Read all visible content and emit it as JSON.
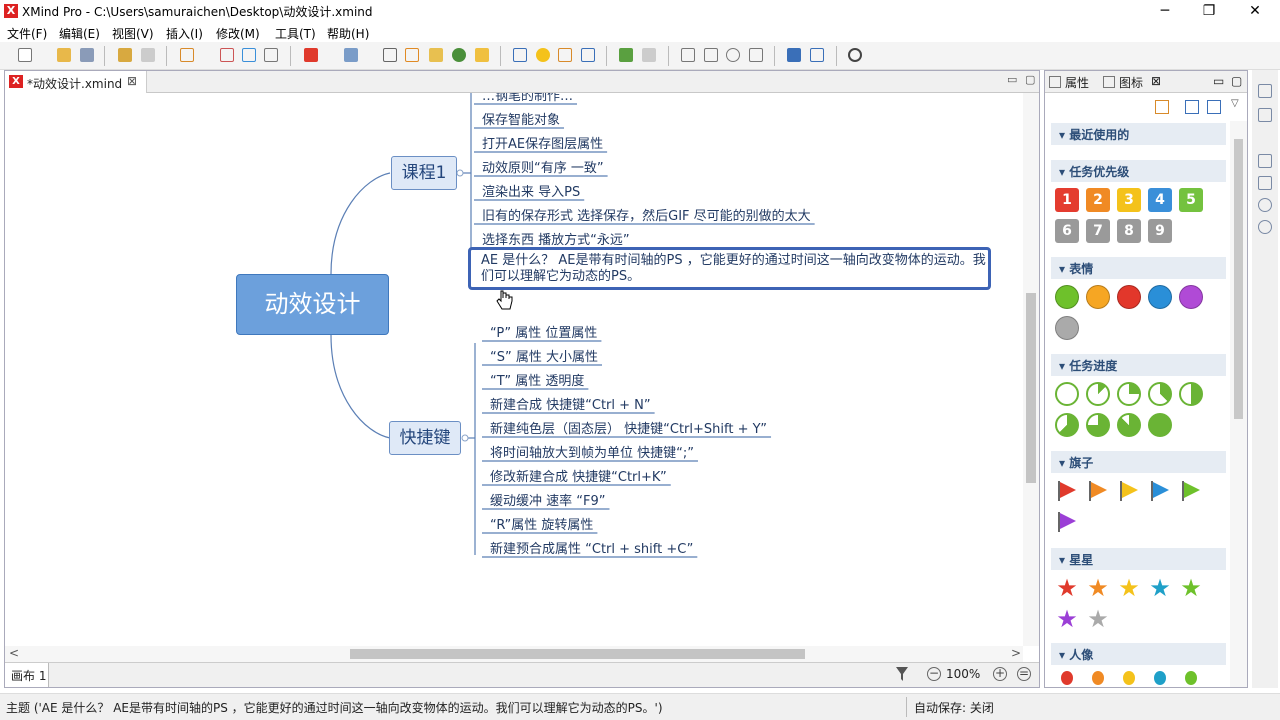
{
  "window": {
    "title": "XMind Pro - C:\\Users\\samuraichen\\Desktop\\动效设计.xmind",
    "logo": "X",
    "minimize": "─",
    "maximize": "❐",
    "close": "✕"
  },
  "menu": [
    "文件(F)",
    "编辑(E)",
    "视图(V)",
    "插入(I)",
    "修改(M)",
    "工具(T)",
    "帮助(H)"
  ],
  "editor": {
    "tab_label": "*动效设计.xmind",
    "tab_close": "⊠",
    "minimize": "▭",
    "maximize": "▢"
  },
  "mindmap": {
    "root": "动效设计",
    "branches": [
      {
        "label": "课程1",
        "topics": [
          "保存智能对象",
          "打开AE保存图层属性",
          "动效原则“有序 一致”",
          "渲染出来 导入PS",
          "旧有的保存形式 选择保存，然后GIF 尽可能的别做的太大",
          "选择东西 播放方式“永远”"
        ],
        "cut_topic": "…钢笔的制作…",
        "selected_topic": "AE 是什么？ AE是带有时间轴的PS ，它能更好的通过时间这一轴向改变物体的运动。我们可以理解它为动态的PS。"
      },
      {
        "label": "快捷键",
        "topics": [
          "“P” 属性  位置属性",
          "“S” 属性 大小属性",
          "“T” 属性 透明度",
          "新建合成  快捷键“Ctrl + N”",
          "新建纯色层（固态层） 快捷键“Ctrl+Shift + Y”",
          "将时间轴放大到帧为单位 快捷键“;”",
          "修改新建合成 快捷键“Ctrl+K”",
          "缓动缓冲 速率 “F9”",
          "“R”属性  旋转属性",
          "新建预合成属性 “Ctrl +  shift +C”"
        ]
      }
    ]
  },
  "bottom": {
    "sheet_tab": "画布 1",
    "zoom": "100%",
    "zoom_out": "−",
    "zoom_in": "+",
    "zoom_fit": "=",
    "scroll_left": "<",
    "scroll_right": ">"
  },
  "side_panel": {
    "tabs": [
      "属性",
      "图标"
    ],
    "close": "⊠",
    "sections": [
      "最近使用的",
      "任务优先级",
      "表情",
      "任务进度",
      "旗子",
      "星星",
      "人像"
    ],
    "priorities": [
      "1",
      "2",
      "3",
      "4",
      "5",
      "6",
      "7",
      "8",
      "9"
    ],
    "priority_colors": [
      "#e43c2f",
      "#f08a24",
      "#f4c21b",
      "#3a8fd9",
      "#74c23f",
      "#9a9a9a",
      "#9a9a9a",
      "#9a9a9a",
      "#9a9a9a"
    ],
    "smiley_colors": [
      "#6ec12b",
      "#f6a623",
      "#e2372b",
      "#2a8fd8",
      "#b04ad6",
      "#aaaaaa"
    ],
    "flag_colors": [
      "#e03a2c",
      "#f08a24",
      "#f4c21b",
      "#2a8fd8",
      "#6ec12b",
      "#9b3fd6"
    ],
    "star_colors": [
      "#e03a2c",
      "#f08a24",
      "#f4c21b",
      "#1fa0c8",
      "#6ec12b",
      "#9b3fd6",
      "#aaaaaa"
    ],
    "person_colors": [
      "#e03a2c",
      "#f08a24",
      "#f4c21b",
      "#1fa0c8",
      "#6ec12b"
    ],
    "progress_levels": [
      0,
      0.125,
      0.25,
      0.375,
      0.5,
      0.625,
      0.75,
      0.875,
      1
    ]
  },
  "status": {
    "text": "主题 ('AE 是什么？ AE是带有时间轴的PS ，它能更好的通过时间这一轴向改变物体的运动。我们可以理解它为动态的PS。')",
    "autosave": "自动保存: 关闭"
  }
}
